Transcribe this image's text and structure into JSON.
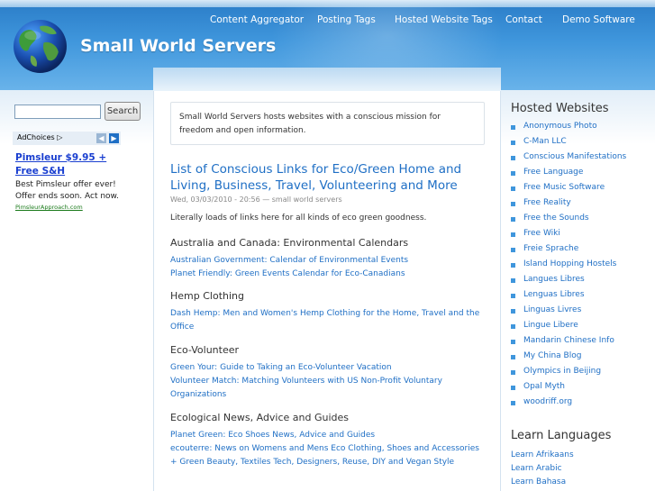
{
  "site": {
    "title": "Small World Servers"
  },
  "nav": {
    "items": [
      "Content Aggregator",
      "Posting Tags",
      "Hosted Website Tags",
      "Contact",
      "Demo Software"
    ]
  },
  "search": {
    "button_label": "Search",
    "value": ""
  },
  "ad": {
    "choices_label": "AdChoices",
    "title": "Pimsleur $9.95 + Free S&H",
    "text": "Best Pimsleur offer ever! Offer ends soon. Act now.",
    "url": "PimsleurApproach.com",
    "prev_icon": "chevron-left-icon",
    "next_icon": "chevron-right-icon"
  },
  "intro": {
    "text": "Small World Servers hosts websites with a conscious mission for freedom and open information."
  },
  "post": {
    "title": "List of Conscious Links for Eco/Green Home and Living, Business, Travel, Volunteering and More",
    "meta": "Wed, 03/03/2010 - 20:56 — small world servers",
    "lead": "Literally loads of links here for all kinds of eco green goodness.",
    "sections": [
      {
        "heading": "Australia and Canada: Environmental Calendars",
        "links": [
          "Australian Government: Calendar of Environmental Events",
          "Planet Friendly: Green Events Calendar for Eco-Canadians"
        ]
      },
      {
        "heading": "Hemp Clothing",
        "links": [
          "Dash Hemp: Men and Women's Hemp Clothing for the Home, Travel and the Office"
        ]
      },
      {
        "heading": "Eco-Volunteer",
        "links": [
          "Green Your: Guide to Taking an Eco-Volunteer Vacation",
          "Volunteer Match: Matching Volunteers with US Non-Profit Voluntary Organizations"
        ]
      },
      {
        "heading": "Ecological News, Advice and Guides",
        "links": [
          "Planet Green: Eco Shoes News, Advice and Guides",
          "ecouterre: News on Womens and Mens Eco Clothing, Shoes and Accessories + Green Beauty, Textiles Tech, Designers, Reuse, DIY and Vegan Style"
        ]
      }
    ]
  },
  "hosted": {
    "heading": "Hosted Websites",
    "items": [
      "Anonymous Photo",
      "C-Man LLC",
      "Conscious Manifestations",
      "Free Language",
      "Free Music Software",
      "Free Reality",
      "Free the Sounds",
      "Free Wiki",
      "Freie Sprache",
      "Island Hopping Hostels",
      "Langues Libres",
      "Lenguas Libres",
      "Linguas Livres",
      "Lingue Libere",
      "Mandarin Chinese Info",
      "My China Blog",
      "Olympics in Beijing",
      "Opal Myth",
      "woodriff.org"
    ]
  },
  "languages": {
    "heading": "Learn Languages",
    "items": [
      "Learn Afrikaans",
      "Learn Arabic",
      "Learn Bahasa"
    ]
  },
  "colors": {
    "link": "#1f6fc5",
    "header": "#3f96dc"
  }
}
